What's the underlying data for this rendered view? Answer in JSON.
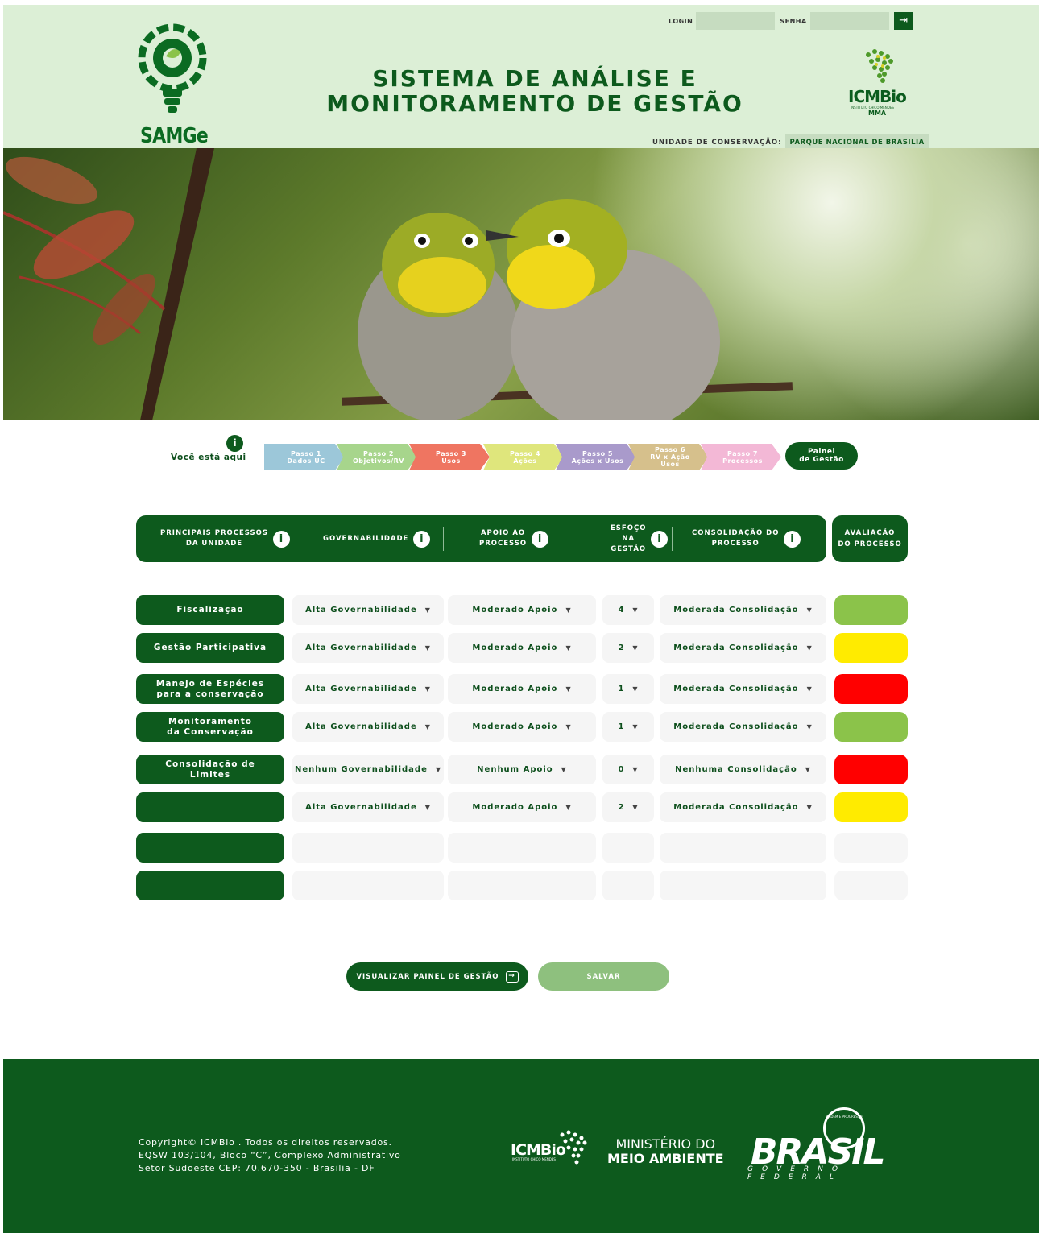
{
  "header": {
    "logo_text": "SAMGe",
    "title_line1": "SISTEMA DE ANÁLISE E",
    "title_line2": "MONITORAMENTO DE GESTÃO",
    "login_label": "LOGIN",
    "senha_label": "SENHA",
    "login_value": "",
    "senha_value": "",
    "submit_icon": "enter-icon",
    "partner_logo_text": "ICMBio",
    "partner_logo_sub": "INSTITUTO CHICO MENDES",
    "partner_logo_mma": "MMA",
    "uc_label": "UNIDADE DE CONSERVAÇÃO:",
    "uc_value": "PARQUE NACIONAL DE BRASILIA"
  },
  "steps": {
    "here_label": "Você está aqui",
    "here_icon": "info-icon",
    "items": [
      {
        "line1": "Passo 1",
        "line2": "Dados UC",
        "line3": "",
        "color": "#9cc7d9"
      },
      {
        "line1": "Passo 2",
        "line2": "Objetivos/RV",
        "line3": "",
        "color": "#a7d58c"
      },
      {
        "line1": "Passo 3",
        "line2": "Usos",
        "line3": "",
        "color": "#ef7561"
      },
      {
        "line1": "Passo 4",
        "line2": "Ações",
        "line3": "",
        "color": "#dfe67c"
      },
      {
        "line1": "Passo 5",
        "line2": "Ações x Usos",
        "line3": "",
        "color": "#a99acb"
      },
      {
        "line1": "Passo 6",
        "line2": "RV x Ação",
        "line3": "Usos",
        "color": "#d6c08c"
      },
      {
        "line1": "Passo 7",
        "line2": "Processos",
        "line3": "",
        "color": "#f3b8d6"
      }
    ],
    "painel_line1": "Painel",
    "painel_line2": "de Gestão"
  },
  "table": {
    "headers": {
      "processos_1": "PRINCIPAIS PROCESSOS",
      "processos_2": "DA UNIDADE",
      "governabilidade": "GOVERNABILIDADE",
      "apoio_1": "APOIO AO",
      "apoio_2": "PROCESSO",
      "esforco_1": "ESFOÇO",
      "esforco_2": "NA",
      "esforco_3": "GESTÃO",
      "consolidacao_1": "CONSOLIDAÇÃO DO",
      "consolidacao_2": "PROCESSO",
      "avaliacao_1": "AVALIAÇÃO",
      "avaliacao_2": "DO PROCESSO"
    },
    "rows": [
      {
        "proc1": "Fiscalização",
        "proc2": "",
        "gov": "Alta Governabilidade",
        "apoio": "Moderado Apoio",
        "esforco": "4",
        "cons": "Moderada Consolidação",
        "aval_color": "#8bc34a"
      },
      {
        "proc1": "Gestão Participativa",
        "proc2": "",
        "gov": "Alta Governabilidade",
        "apoio": "Moderado Apoio",
        "esforco": "2",
        "cons": "Moderada Consolidação",
        "aval_color": "#ffeb00"
      },
      {
        "proc1": "Manejo de Espécies",
        "proc2": "para a conservação",
        "gov": "Alta Governabilidade",
        "apoio": "Moderado Apoio",
        "esforco": "1",
        "cons": "Moderada Consolidação",
        "aval_color": "#ff0000"
      },
      {
        "proc1": "Monitoramento",
        "proc2": "da Conservação",
        "gov": "Alta Governabilidade",
        "apoio": "Moderado Apoio",
        "esforco": "1",
        "cons": "Moderada Consolidação",
        "aval_color": "#8bc34a"
      },
      {
        "proc1": "Consolidação de",
        "proc2": "Limites",
        "gov": "Nenhum Governabilidade",
        "apoio": "Nenhum Apoio",
        "esforco": "0",
        "cons": "Nenhuma Consolidação",
        "aval_color": "#ff0000"
      },
      {
        "proc1": "",
        "proc2": "",
        "gov": "Alta Governabilidade",
        "apoio": "Moderado Apoio",
        "esforco": "2",
        "cons": "Moderada Consolidação",
        "aval_color": "#ffeb00"
      },
      {
        "proc1": "",
        "proc2": "",
        "gov": "",
        "apoio": "",
        "esforco": "",
        "cons": "",
        "aval_color": "#f6f6f6"
      },
      {
        "proc1": "",
        "proc2": "",
        "gov": "",
        "apoio": "",
        "esforco": "",
        "cons": "",
        "aval_color": "#f6f6f6"
      }
    ]
  },
  "actions": {
    "visualizar": "VISUALIZAR PAINEL DE GESTÃO",
    "salvar": "SALVAR"
  },
  "footer": {
    "copy_line1": "Copyright© ICMBio . Todos os direitos reservados.",
    "copy_line2": "EQSW 103/104, Bloco “C”, Complexo Administrativo",
    "copy_line3": "Setor Sudoeste CEP: 70.670-350 - Brasilia - DF",
    "icm_text": "ICMBio",
    "icm_sub": "INSTITUTO CHICO MENDES",
    "mma_line1": "MINISTÉRIO DO",
    "mma_line2": "MEIO AMBIENTE",
    "brasil_text": "BRASIL",
    "brasil_sub": "GOVERNO FEDERAL",
    "brasil_motto": "ORDEM E PROGRESSO"
  },
  "colors": {
    "primary": "#0d5a1d",
    "header_bg": "#dcefd6",
    "green_status": "#8bc34a",
    "yellow_status": "#ffeb00",
    "red_status": "#ff0000",
    "salvar_bg": "#8ec07e"
  }
}
